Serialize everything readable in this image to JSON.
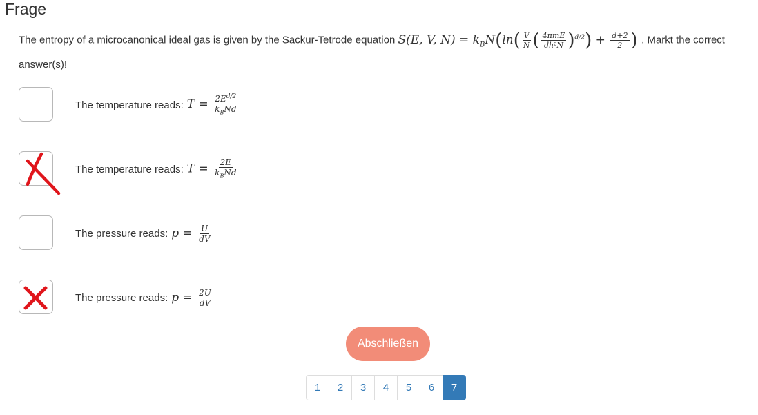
{
  "header": {
    "title": "Frage"
  },
  "question": {
    "text_before": "The entropy of a microcanonical ideal gas is given by the Sackur-Tetrode equation",
    "text_after": ". Markt the correct answer(s)!",
    "formula": {
      "lhs": "S(E, V, N) = k",
      "lhs_sub": "B",
      "n": "N",
      "ln": "ln",
      "v_num": "V",
      "v_den": "N",
      "inner_num": "4πmE",
      "inner_den": "dh²N",
      "exponent": "d/2",
      "plus": "+",
      "tail_num": "d+2",
      "tail_den": "2"
    }
  },
  "options": [
    {
      "label": "The temperature reads:",
      "lhs": "T =",
      "num": "2E^(d/2)",
      "den": "k_B N d",
      "checked": false,
      "marker": "none"
    },
    {
      "label": "The temperature reads:",
      "lhs": "T =",
      "num": "2E",
      "den": "k_B N d",
      "checked": true,
      "marker": "red-hand-x"
    },
    {
      "label": "The pressure reads:",
      "lhs": "p =",
      "num": "U",
      "den": "dV",
      "checked": false,
      "marker": "none"
    },
    {
      "label": "The pressure reads:",
      "lhs": "p =",
      "num": "2U",
      "den": "dV",
      "checked": true,
      "marker": "red-x"
    }
  ],
  "actions": {
    "submit_label": "Abschließen"
  },
  "pagination": {
    "pages": [
      "1",
      "2",
      "3",
      "4",
      "5",
      "6",
      "7"
    ],
    "active": "7"
  },
  "colors": {
    "submit_bg": "#f28c78",
    "active_page_bg": "#337ab7",
    "link": "#337ab7",
    "mark_red": "#e0151b"
  }
}
